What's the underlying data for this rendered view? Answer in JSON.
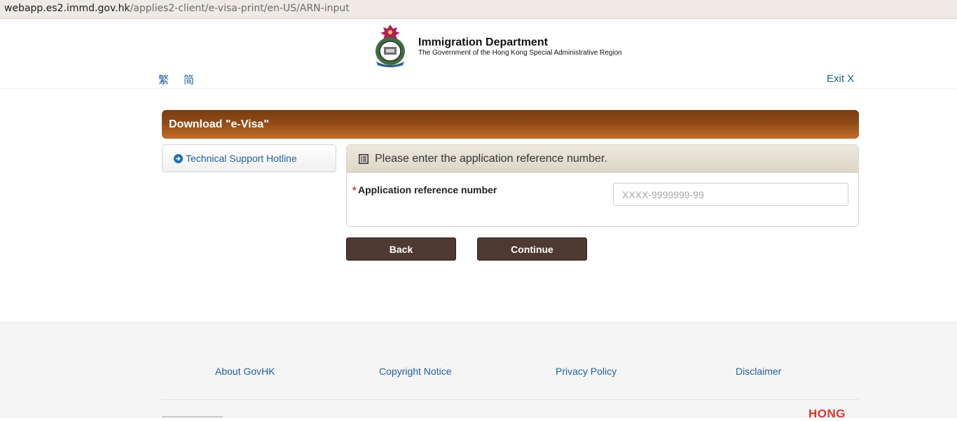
{
  "browser": {
    "url_host": "webapp.es2.immd.gov.hk",
    "url_path": "/applies2-client/e-visa-print/en-US/ARN-input"
  },
  "header": {
    "dept_title": "Immigration Department",
    "dept_subtitle": "The Government of the Hong Kong Special Administrative Region",
    "lang_traditional": "繁",
    "lang_simplified": "简",
    "exit_label": "Exit X"
  },
  "main": {
    "page_title": "Download \"e-Visa\"",
    "support_link": "Technical Support Hotline",
    "panel_heading": "Please enter the application reference number.",
    "required_mark": "*",
    "field_label": "Application reference number",
    "field_placeholder": "XXXX-9999999-99",
    "field_value": "",
    "back_label": "Back",
    "continue_label": "Continue"
  },
  "footer": {
    "links": [
      "About GovHK",
      "Copyright Notice",
      "Privacy Policy",
      "Disclaimer"
    ],
    "brand_word": "HONG"
  },
  "colors": {
    "title_bar": "#8f4a16",
    "button": "#4e3a32",
    "link": "#1f5f9e",
    "brand": "#e0352b"
  }
}
